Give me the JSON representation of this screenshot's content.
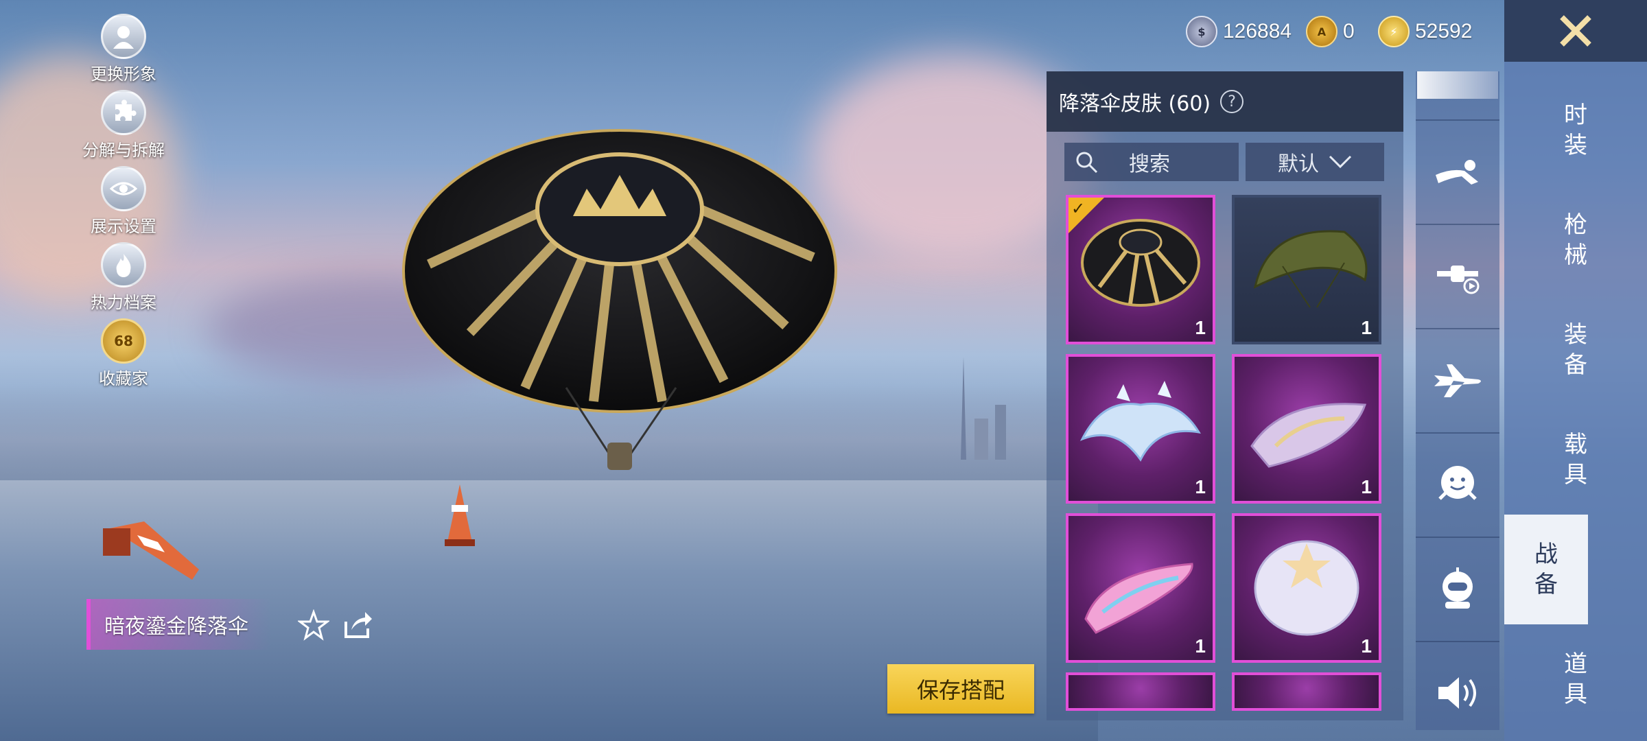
{
  "left_menu": [
    {
      "label": "更换形象",
      "icon": "avatar-icon"
    },
    {
      "label": "分解与拆解",
      "icon": "puzzle-icon"
    },
    {
      "label": "展示设置",
      "icon": "eye-icon"
    },
    {
      "label": "热力档案",
      "icon": "flame-icon"
    },
    {
      "label": "收藏家",
      "icon": "collector-badge-icon",
      "badge": "68"
    }
  ],
  "item_name": "暗夜鎏金降落伞",
  "currency": [
    {
      "value": "126884",
      "icon": "silver-coin-icon",
      "color": "#9aa4c6"
    },
    {
      "value": "0",
      "icon": "a-coin-icon",
      "color": "#e0a21c"
    },
    {
      "value": "52592",
      "icon": "bp-coin-icon",
      "color": "#f3c631"
    }
  ],
  "panel": {
    "title": "降落伞皮肤 (60)",
    "search_placeholder": "搜索",
    "sort_label": "默认",
    "items": [
      {
        "count": "1",
        "selected": true,
        "style": "purple"
      },
      {
        "count": "1",
        "selected": false,
        "style": "plain"
      },
      {
        "count": "1",
        "selected": false,
        "style": "purple"
      },
      {
        "count": "1",
        "selected": false,
        "style": "purple"
      },
      {
        "count": "1",
        "selected": false,
        "style": "purple"
      },
      {
        "count": "1",
        "selected": false,
        "style": "purple"
      }
    ]
  },
  "save_button": "保存搭配",
  "sub_categories": [
    "skydive-icon",
    "drone-icon",
    "plane-icon",
    "emote-icon",
    "companion-icon",
    "speaker-icon"
  ],
  "categories": [
    {
      "label": "时装",
      "active": false
    },
    {
      "label": "枪械",
      "active": false
    },
    {
      "label": "装备",
      "active": false
    },
    {
      "label": "载具",
      "active": false
    },
    {
      "label": "战备",
      "active": true
    },
    {
      "label": "道具",
      "active": false
    }
  ],
  "colors": {
    "accent": "#e14fd8",
    "gold": "#f0b423",
    "panel": "#283248"
  }
}
